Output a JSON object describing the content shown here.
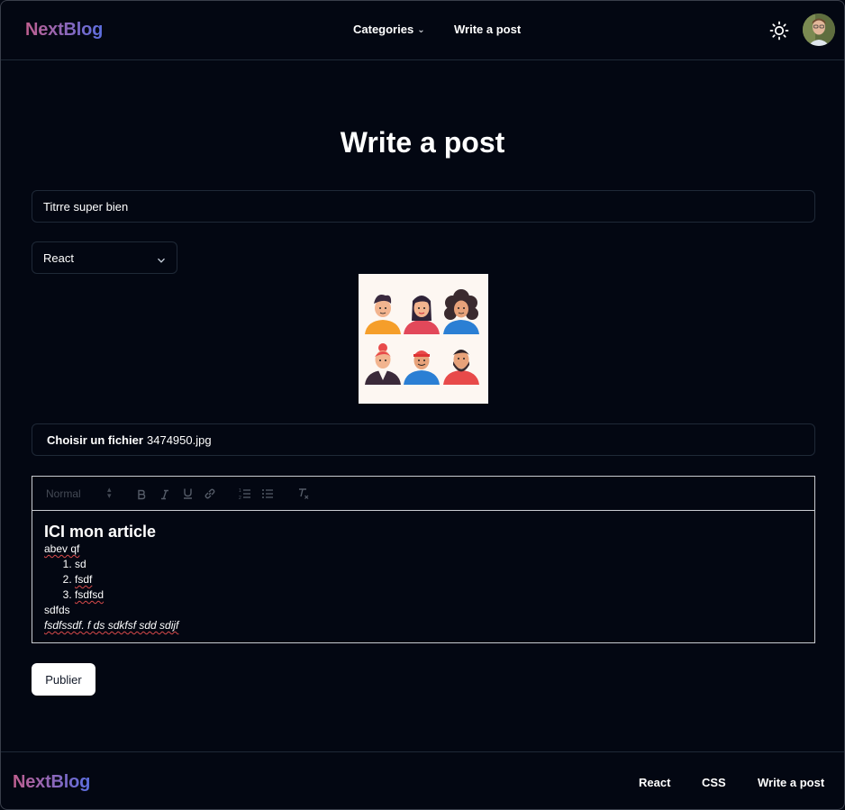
{
  "header": {
    "logo": "NextBlog",
    "nav": {
      "categories": "Categories",
      "write": "Write a post"
    },
    "theme_icon": "sun-icon",
    "avatar_icon": "user-avatar"
  },
  "main": {
    "title": "Write a post",
    "title_input_value": "Titrre super bien",
    "category_value": "React",
    "file_button": "Choisir un fichier",
    "file_name": "3474950.jpg",
    "editor": {
      "heading_select": "Normal",
      "toolbar_icons": [
        "bold-icon",
        "italic-icon",
        "underline-icon",
        "link-icon",
        "ordered-list-icon",
        "bullet-list-icon",
        "clear-format-icon"
      ],
      "h1": "ICI mon article",
      "p1": "abev qf",
      "list": [
        "sd",
        "fsdf",
        "fsdfsd"
      ],
      "p2": "sdfds",
      "p3": "fsdfssdf. f ds sdkfsf sdd  sdijf"
    },
    "publish_label": "Publier"
  },
  "footer": {
    "logo": "NextBlog",
    "links": [
      "React",
      "CSS",
      "Write a post"
    ]
  },
  "colors": {
    "background": "#030712",
    "border": "#1f2937",
    "logo_start": "#c05f8f",
    "logo_end": "#5b6ee0"
  }
}
